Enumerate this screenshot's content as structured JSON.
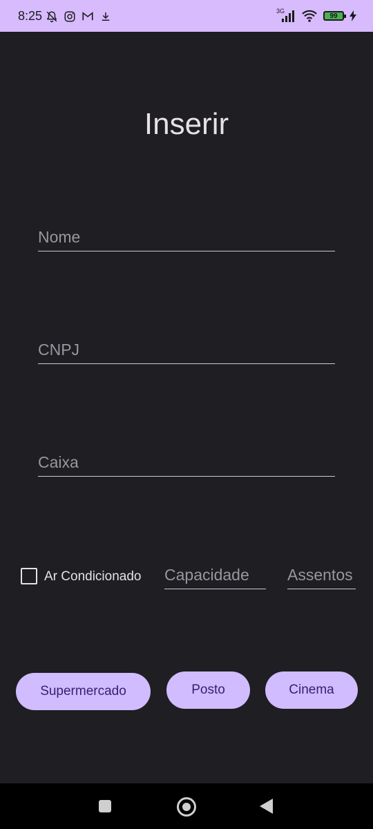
{
  "status_bar": {
    "time": "8:25",
    "network": "3G",
    "battery": "99"
  },
  "screen": {
    "title": "Inserir"
  },
  "form": {
    "nome_placeholder": "Nome",
    "cnpj_placeholder": "CNPJ",
    "caixa_placeholder": "Caixa",
    "ar_condicionado_label": "Ar Condicionado",
    "ar_condicionado_checked": false,
    "capacidade_placeholder": "Capacidade",
    "assentos_placeholder": "Assentos"
  },
  "buttons": {
    "supermercado": "Supermercado",
    "posto": "Posto",
    "cinema": "Cinema"
  },
  "colors": {
    "status_bar": "#d7bbfd",
    "background": "#1f1e22",
    "button": "#d0bcff",
    "button_text": "#381e72"
  },
  "icons": [
    "notifications-off-icon",
    "instagram-icon",
    "gmail-icon",
    "download-icon",
    "signal-icon",
    "wifi-icon",
    "battery-icon",
    "charging-icon"
  ]
}
